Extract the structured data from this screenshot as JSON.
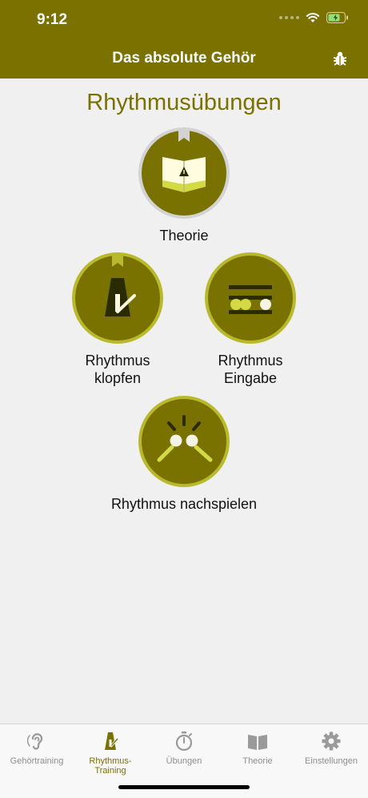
{
  "status_bar": {
    "time": "9:12"
  },
  "nav": {
    "title": "Das absolute Gehör",
    "bug_icon": "bug-icon"
  },
  "page": {
    "title": "Rhythmusübungen"
  },
  "exercises": [
    {
      "label": "Theorie",
      "icon": "theory-book-icon"
    },
    {
      "label_line1": "Rhythmus",
      "label_line2": "klopfen",
      "icon": "metronome-icon"
    },
    {
      "label_line1": "Rhythmus",
      "label_line2": "Eingabe",
      "icon": "rhythm-input-icon"
    },
    {
      "label": "Rhythmus nachspielen",
      "icon": "rhythm-replay-icon"
    }
  ],
  "tabs": [
    {
      "label": "Gehörtraining",
      "icon": "ear-icon"
    },
    {
      "label": "Rhythmus-Training",
      "icon": "metronome-icon",
      "active": true
    },
    {
      "label": "Übungen",
      "icon": "stopwatch-icon"
    },
    {
      "label": "Theorie",
      "icon": "book-icon"
    },
    {
      "label": "Einstellungen",
      "icon": "gear-icon"
    }
  ],
  "colors": {
    "brand": "#7a7100",
    "accent_light": "#d4da46",
    "background": "#f0f0f0"
  }
}
